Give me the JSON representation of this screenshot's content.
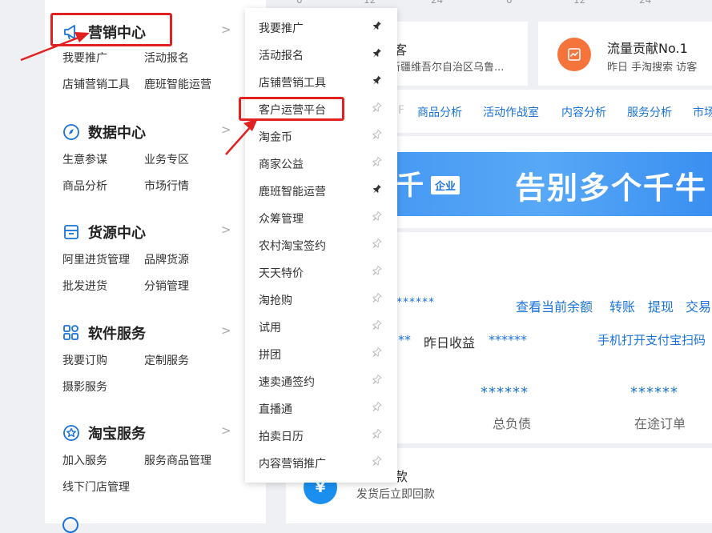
{
  "top_axis": {
    "labels": [
      "0",
      "12",
      "24",
      "0",
      "12",
      "24"
    ]
  },
  "sidebar": {
    "sections": [
      {
        "title": "营销中心",
        "icon": "megaphone-icon",
        "items": [
          "我要推广",
          "活动报名",
          "店铺营销工具",
          "鹿班智能运营"
        ]
      },
      {
        "title": "数据中心",
        "icon": "compass-icon",
        "items": [
          "生意参谋",
          "业务专区",
          "商品分析",
          "市场行情"
        ]
      },
      {
        "title": "货源中心",
        "icon": "box-icon",
        "items": [
          "阿里进货管理",
          "品牌货源",
          "批发进货",
          "分销管理"
        ]
      },
      {
        "title": "软件服务",
        "icon": "grid-icon",
        "items": [
          "我要订购",
          "定制服务",
          "摄影服务"
        ]
      },
      {
        "title": "淘宝服务",
        "icon": "star-badge-icon",
        "items": [
          "加入服务",
          "服务商品管理",
          "线下门店管理"
        ]
      }
    ]
  },
  "flyout": {
    "items": [
      {
        "label": "我要推广",
        "pinned": true
      },
      {
        "label": "活动报名",
        "pinned": true
      },
      {
        "label": "店铺营销工具",
        "pinned": true
      },
      {
        "label": "客户运营平台",
        "pinned": false
      },
      {
        "label": "淘金币",
        "pinned": false
      },
      {
        "label": "商家公益",
        "pinned": false
      },
      {
        "label": "鹿班智能运营",
        "pinned": true
      },
      {
        "label": "众筹管理",
        "pinned": false
      },
      {
        "label": "农村淘宝签约",
        "pinned": false
      },
      {
        "label": "天天特价",
        "pinned": false
      },
      {
        "label": "淘抢购",
        "pinned": false
      },
      {
        "label": "试用",
        "pinned": false
      },
      {
        "label": "拼团",
        "pinned": false
      },
      {
        "label": "速卖通签约",
        "pinned": false
      },
      {
        "label": "直播通",
        "pinned": false
      },
      {
        "label": "拍卖日历",
        "pinned": false
      },
      {
        "label": "内容营销推广",
        "pinned": false
      }
    ]
  },
  "content": {
    "card1": {
      "title": "客",
      "sub": "新疆维吾尔自治区乌鲁..."
    },
    "card2": {
      "title": "流量贡献No.1",
      "sub": "昨日 手淘搜索 访客"
    },
    "tabs": [
      "商品分析",
      "活动作战室",
      "内容分析",
      "服务分析",
      "市场"
    ],
    "banner": {
      "badge": "企业",
      "text": "告别多个千牛",
      "lead": "千"
    },
    "finance": {
      "masked1": "******",
      "links1": [
        "查看当前余额",
        "转账",
        "提现",
        "交易"
      ],
      "masked2": "**",
      "yesterday_label": "昨日收益",
      "masked3": "******",
      "alipay_link": "手机打开支付宝扫码"
    },
    "stats": [
      {
        "value": "******",
        "label": "总负债"
      },
      {
        "value": "******",
        "label": "在途订单"
      }
    ],
    "payment": {
      "title": "款",
      "sub": "发货后立即回款"
    }
  },
  "colors": {
    "accent": "#1a73d9",
    "annotation": "#e02222",
    "orange": "#f5743c"
  }
}
